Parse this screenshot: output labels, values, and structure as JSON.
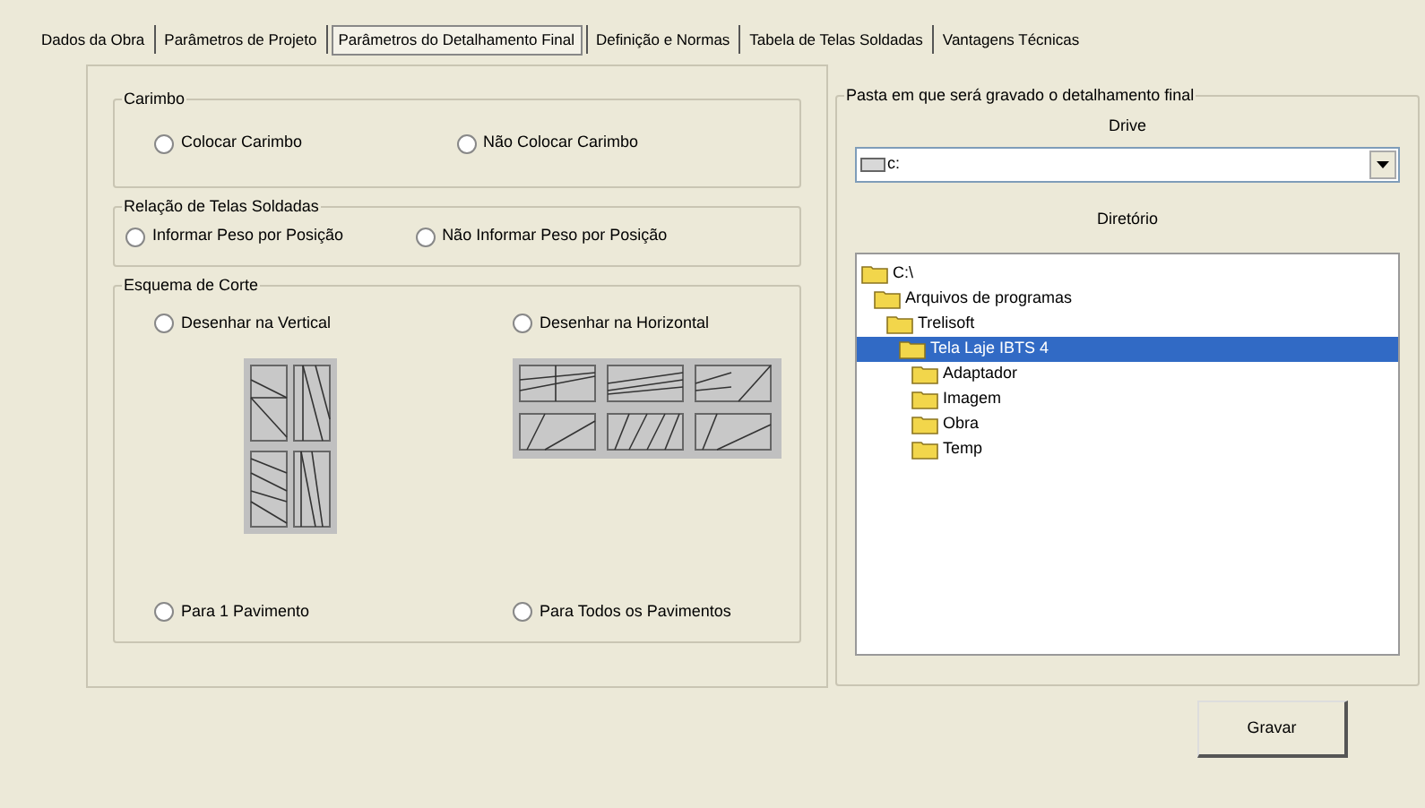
{
  "tabs": [
    {
      "label": "Dados da Obra",
      "selected": false
    },
    {
      "label": "Parâmetros de Projeto",
      "selected": false
    },
    {
      "label": "Parâmetros do Detalhamento Final",
      "selected": true
    },
    {
      "label": "Definição e Normas",
      "selected": false
    },
    {
      "label": "Tabela de Telas Soldadas",
      "selected": false
    },
    {
      "label": "Vantagens Técnicas",
      "selected": false
    }
  ],
  "carimbo": {
    "title": "Carimbo",
    "options": [
      {
        "label": "Colocar Carimbo",
        "selected": false
      },
      {
        "label": "Não Colocar Carimbo",
        "selected": false
      }
    ]
  },
  "relacao": {
    "title": "Relação de Telas Soldadas",
    "options": [
      {
        "label": "Informar Peso por Posição",
        "selected": false
      },
      {
        "label": "Não Informar Peso por Posição",
        "selected": false
      }
    ]
  },
  "esquema": {
    "title": "Esquema de Corte",
    "direction": [
      {
        "label": "Desenhar na Vertical",
        "selected": false
      },
      {
        "label": "Desenhar na Horizontal",
        "selected": false
      }
    ],
    "scope": [
      {
        "label": "Para 1 Pavimento",
        "selected": false
      },
      {
        "label": "Para Todos os Pavimentos",
        "selected": false
      }
    ]
  },
  "pasta": {
    "title": "Pasta em que será gravado o detalhamento final",
    "drive_label": "Drive",
    "drive_value": "c:",
    "dir_label": "Diretório",
    "tree": [
      {
        "label": "C:\\",
        "selected": false,
        "children": [
          {
            "label": "Arquivos de programas",
            "selected": false,
            "children": [
              {
                "label": "Trelisoft",
                "selected": false,
                "children": [
                  {
                    "label": "Tela Laje IBTS 4",
                    "selected": true,
                    "children": [
                      {
                        "label": "Adaptador",
                        "selected": false
                      },
                      {
                        "label": "Imagem",
                        "selected": false
                      },
                      {
                        "label": "Obra",
                        "selected": false
                      },
                      {
                        "label": "Temp",
                        "selected": false
                      }
                    ]
                  }
                ]
              }
            ]
          }
        ]
      }
    ]
  },
  "save_button": "Gravar"
}
